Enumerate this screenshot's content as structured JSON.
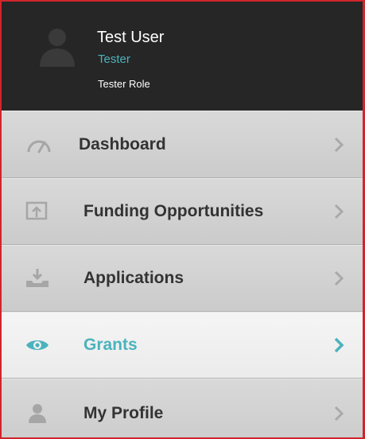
{
  "profile": {
    "name": "Test User",
    "title": "Tester",
    "role": "Tester Role",
    "avatar_icon": "user-silhouette-icon"
  },
  "nav": {
    "items": [
      {
        "label": "Dashboard",
        "icon": "speedometer-icon",
        "active": false
      },
      {
        "label": "Funding Opportunities",
        "icon": "monitor-upload-icon",
        "active": false
      },
      {
        "label": "Applications",
        "icon": "tray-download-icon",
        "active": false
      },
      {
        "label": "Grants",
        "icon": "eye-icon",
        "active": true
      },
      {
        "label": "My Profile",
        "icon": "user-icon",
        "active": false
      }
    ]
  },
  "colors": {
    "accent": "#4ab3bd",
    "header_bg": "#262626",
    "frame_border": "#d0252b",
    "label_text": "#333333",
    "icon_muted": "#a6a6a6",
    "chevron_muted": "#a9a9a9"
  }
}
